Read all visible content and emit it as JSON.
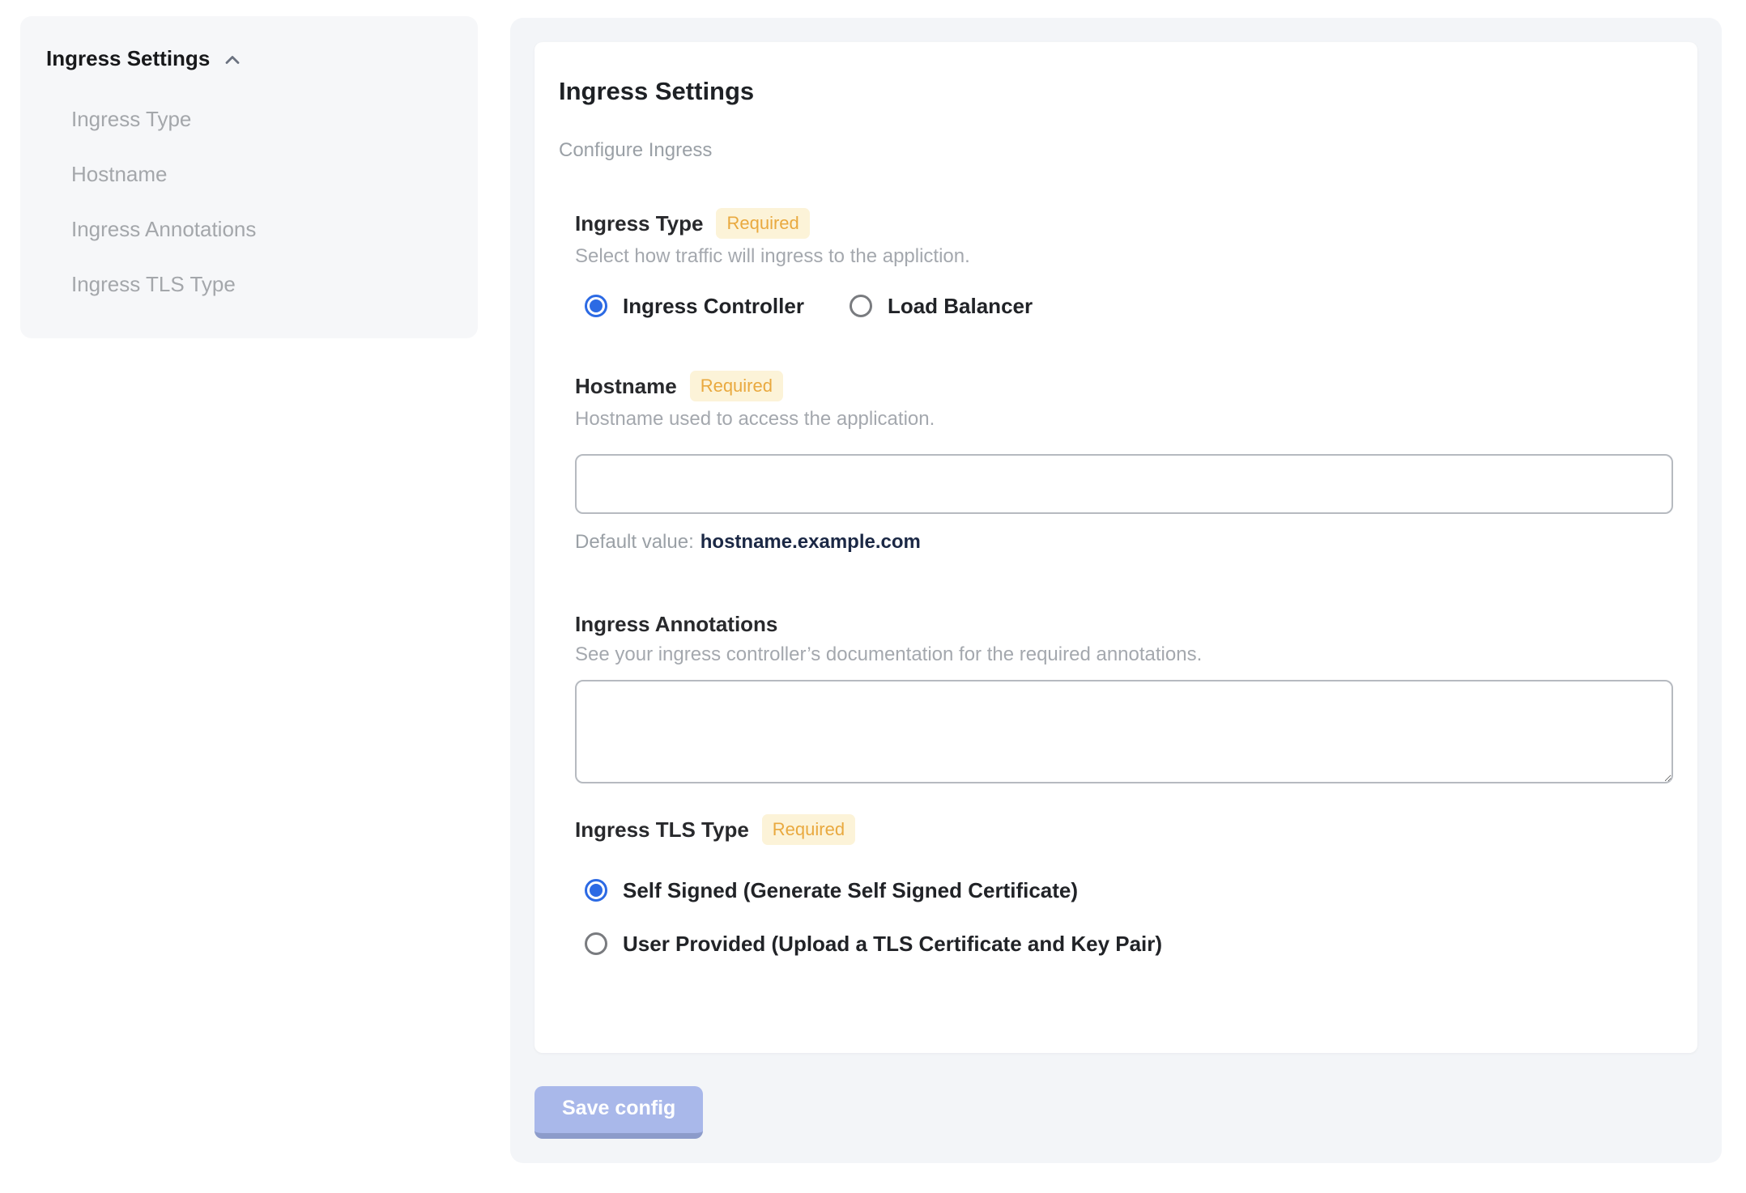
{
  "sidebar": {
    "title": "Ingress Settings",
    "chevron_icon": "chevron-up-icon",
    "items": [
      {
        "label": "Ingress Type"
      },
      {
        "label": "Hostname"
      },
      {
        "label": "Ingress Annotations"
      },
      {
        "label": "Ingress TLS Type"
      }
    ]
  },
  "main": {
    "title": "Ingress Settings",
    "subtitle": "Configure Ingress",
    "sections": {
      "ingress_type": {
        "label": "Ingress Type",
        "required": "Required",
        "description": "Select how traffic will ingress to the appliction.",
        "options": [
          {
            "label": "Ingress Controller",
            "selected": true
          },
          {
            "label": "Load Balancer",
            "selected": false
          }
        ]
      },
      "hostname": {
        "label": "Hostname",
        "required": "Required",
        "description": "Hostname used to access the application.",
        "input_value": "",
        "default_value_label": "Default value:",
        "default_value": "hostname.example.com"
      },
      "ingress_annotations": {
        "label": "Ingress Annotations",
        "description": "See your ingress controller’s documentation for the required annotations.",
        "textarea_value": ""
      },
      "ingress_tls_type": {
        "label": "Ingress TLS Type",
        "required": "Required",
        "options": [
          {
            "label": "Self Signed (Generate Self Signed Certificate)",
            "selected": true
          },
          {
            "label": "User Provided (Upload a TLS Certificate and Key Pair)",
            "selected": false
          }
        ]
      }
    }
  },
  "footer": {
    "save_button": "Save config"
  },
  "colors": {
    "accent_blue": "#2c6ae4",
    "badge_bg": "#fcf3d8",
    "badge_text": "#e9a93f",
    "save_button_bg": "#a9b8ea",
    "save_button_edge": "#8c9bca",
    "default_value_text": "#1b2845",
    "panel_bg": "#f3f5f8",
    "sidebar_bg": "#f6f7f9"
  }
}
